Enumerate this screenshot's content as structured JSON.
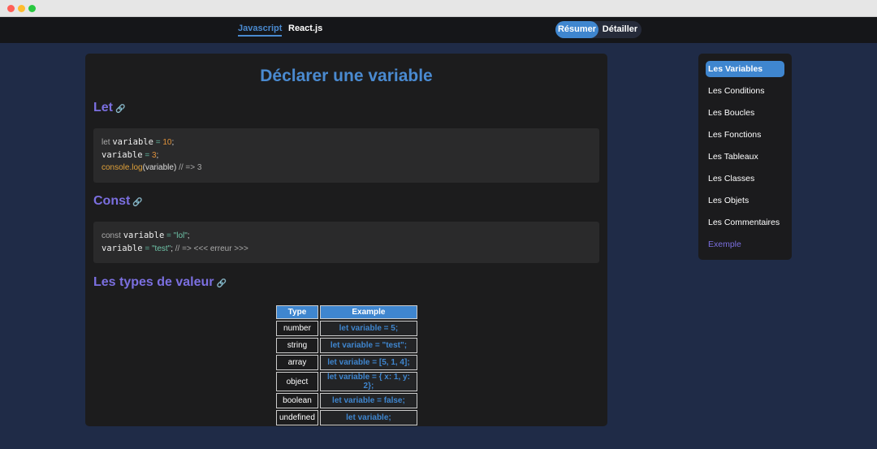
{
  "nav": {
    "tabs": [
      "Javascript",
      "React.js"
    ],
    "toggle": [
      "Résumer",
      "Détailler"
    ]
  },
  "main": {
    "title": "Déclarer une variable",
    "sections": [
      {
        "heading": "Let"
      },
      {
        "heading": "Const"
      },
      {
        "heading": "Les types de valeur"
      }
    ],
    "link_icon": "🔗",
    "let_code": {
      "l1": [
        "let",
        "variable",
        "=",
        "10",
        ";"
      ],
      "l2": [
        "variable",
        "=",
        "3",
        ";"
      ],
      "l3": [
        "console.",
        "log",
        "(variable)",
        "// => 3"
      ]
    },
    "const_code": {
      "l1": [
        "const",
        "variable",
        "=",
        "\"lol\"",
        ";"
      ],
      "l2": [
        "variable",
        "=",
        "\"test\"",
        ";",
        "// => <<< erreur >>>"
      ]
    },
    "table": {
      "headers": [
        "Type",
        "Example"
      ],
      "rows": [
        [
          "number",
          "let variable = 5;"
        ],
        [
          "string",
          "let variable = \"test\";"
        ],
        [
          "array",
          "let variable = [5, 1, 4];"
        ],
        [
          "object",
          "let variable = { x: 1, y: 2};"
        ],
        [
          "boolean",
          "let variable = false;"
        ],
        [
          "undefined",
          "let variable;"
        ]
      ]
    }
  },
  "sidebar": {
    "items": [
      "Les Variables",
      "Les Conditions",
      "Les Boucles",
      "Les Fonctions",
      "Les Tableaux",
      "Les Classes",
      "Les Objets",
      "Les Commentaires",
      "Exemple"
    ]
  }
}
